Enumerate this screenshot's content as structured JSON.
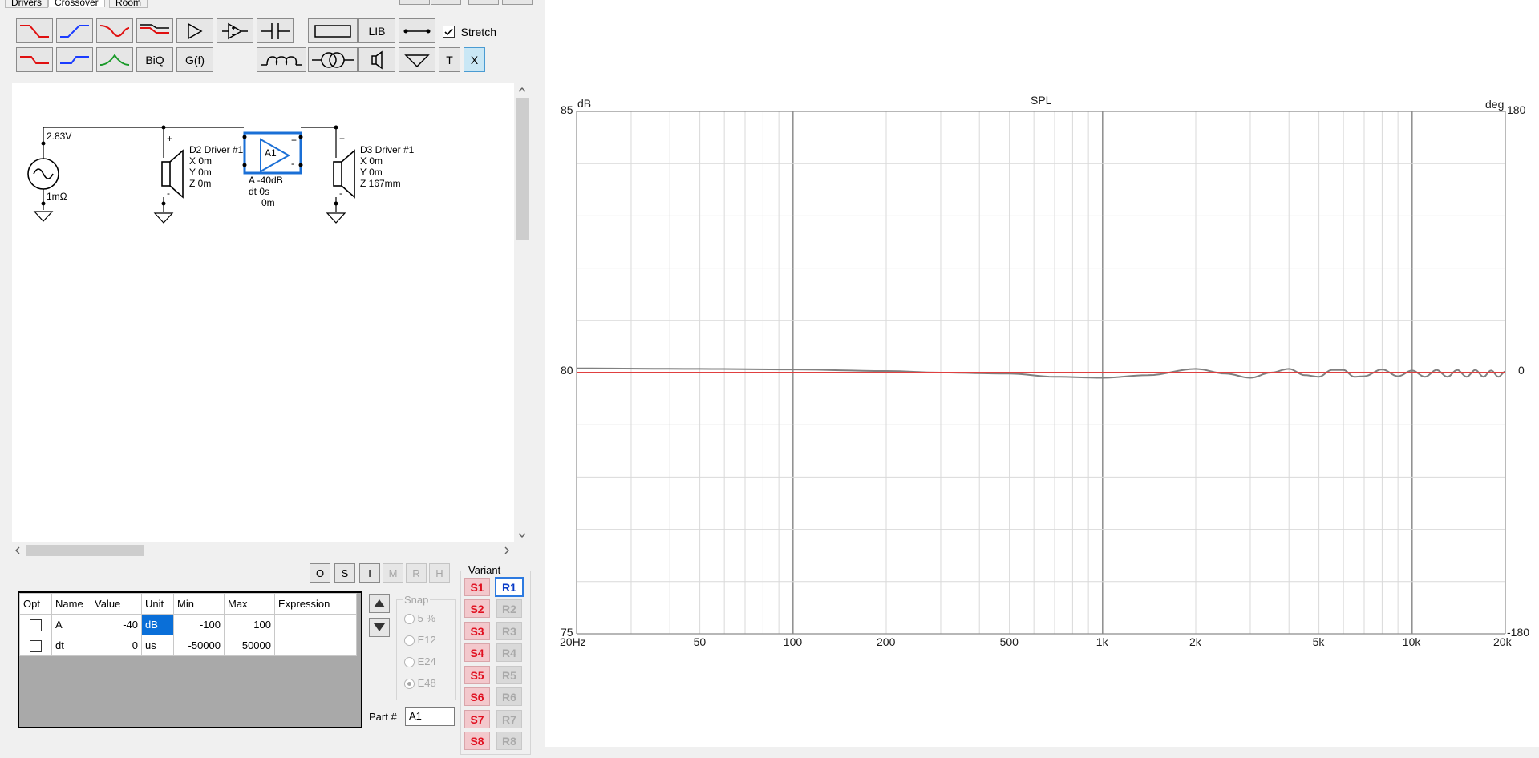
{
  "tabs": [
    "Drivers",
    "Crossover",
    "Room"
  ],
  "toolbar": {
    "bi_q": "BiQ",
    "g_f": "G(f)",
    "lib": "LIB",
    "stretch_label": "Stretch",
    "t": "T",
    "x": "X"
  },
  "schematic": {
    "source_voltage": "2.83V",
    "source_impedance": "1mΩ",
    "d2": {
      "name": "D2 Driver #1",
      "x": "X 0m",
      "y": "Y 0m",
      "z": "Z 0m"
    },
    "amp": {
      "id": "A1",
      "a": "A  -40dB",
      "dt": "dt 0s",
      "dist": "0m"
    },
    "d3": {
      "name": "D3 Driver #1",
      "x": "X 0m",
      "y": "Y 0m",
      "z": "Z 167mm"
    },
    "plus": "+",
    "minus": "-"
  },
  "part_buttons": [
    "O",
    "S",
    "I",
    "M",
    "R",
    "H"
  ],
  "param_table": {
    "headers": [
      "Opt",
      "Name",
      "Value",
      "Unit",
      "Min",
      "Max",
      "Expression"
    ],
    "rows": [
      {
        "name": "A",
        "value": "-40",
        "unit": "dB",
        "min": "-100",
        "max": "100",
        "expr": ""
      },
      {
        "name": "dt",
        "value": "0",
        "unit": "us",
        "min": "-50000",
        "max": "50000",
        "expr": ""
      }
    ]
  },
  "snap": {
    "label": "Snap",
    "options": [
      "5 %",
      "E12",
      "E24",
      "E48"
    ],
    "selected": "E48"
  },
  "part_number": {
    "label": "Part #",
    "value": "A1"
  },
  "variant": {
    "label": "Variant",
    "s": [
      "S1",
      "S2",
      "S3",
      "S4",
      "S5",
      "S6",
      "S7",
      "S8"
    ],
    "r": [
      "R1",
      "R2",
      "R3",
      "R4",
      "R5",
      "R6",
      "R7",
      "R8"
    ],
    "active_r": "R1"
  },
  "graph": {
    "title": "SPL",
    "left_unit": "dB",
    "right_unit": "deg",
    "y_ticks_left": [
      "85",
      "80",
      "75"
    ],
    "y_ticks_right": [
      "180",
      "0",
      "-180"
    ],
    "x_ticks": [
      "20Hz",
      "50",
      "100",
      "200",
      "500",
      "1k",
      "2k",
      "5k",
      "10k",
      "20k"
    ]
  },
  "chart_data": {
    "type": "line",
    "title": "SPL",
    "xlabel": "",
    "ylabel": "dB",
    "y2label": "deg",
    "x_scale": "log",
    "xlim": [
      20,
      20000
    ],
    "ylim": [
      75,
      85
    ],
    "y2lim": [
      -180,
      180
    ],
    "grid": true,
    "series": [
      {
        "color": "#808080",
        "x": [
          20,
          50,
          100,
          200,
          300,
          500,
          700,
          1000,
          1400,
          2000,
          2500,
          3000,
          3500,
          4000,
          4500,
          5000,
          5500,
          6000,
          6500,
          7000,
          8000,
          9000,
          10000,
          11000,
          12000,
          13000,
          14000,
          15000,
          16000,
          17000,
          18000,
          19000,
          20000
        ],
        "y": [
          80.08,
          80.07,
          80.06,
          80.03,
          80.0,
          79.98,
          79.92,
          79.9,
          79.95,
          80.07,
          79.98,
          79.9,
          80.0,
          80.07,
          79.95,
          79.92,
          80.05,
          80.05,
          79.92,
          79.93,
          80.06,
          79.93,
          80.04,
          79.92,
          80.05,
          79.92,
          80.05,
          79.92,
          80.05,
          79.92,
          80.04,
          79.92,
          80.02
        ]
      },
      {
        "color": "#e04040",
        "x": [
          20,
          20000
        ],
        "y": [
          80.0,
          80.0
        ]
      }
    ]
  }
}
